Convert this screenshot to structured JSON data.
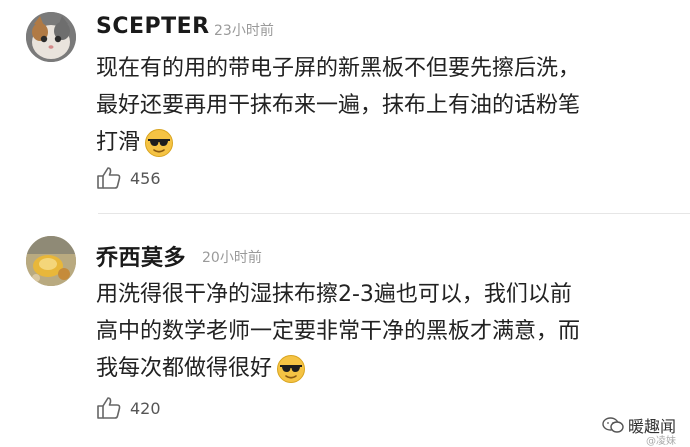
{
  "comments": [
    {
      "username": "SCEPTER",
      "time": "23小时前",
      "lines": [
        "现在有的用的带电子屏的新黑板不但要先擦后洗，",
        "最好还要再用干抹布来一遍，抹布上有油的话粉笔",
        "打滑"
      ],
      "emoji": "sunglasses-emoji",
      "likes": "456"
    },
    {
      "username": "乔西莫多",
      "time": "20小时前",
      "lines": [
        "用洗得很干净的湿抹布擦2-3遍也可以，我们以前",
        "高中的数学老师一定要非常干净的黑板才满意，而",
        "我每次都做得很好"
      ],
      "emoji": "sunglasses-emoji",
      "likes": "420"
    }
  ],
  "watermark": {
    "label": "暖趣闻",
    "handle": "@凌妹"
  },
  "colors": {
    "username": "#1a1a1a",
    "timestamp": "#9a9a9a",
    "divider": "#e6e6e6",
    "emoji_face": "#f5c344"
  }
}
